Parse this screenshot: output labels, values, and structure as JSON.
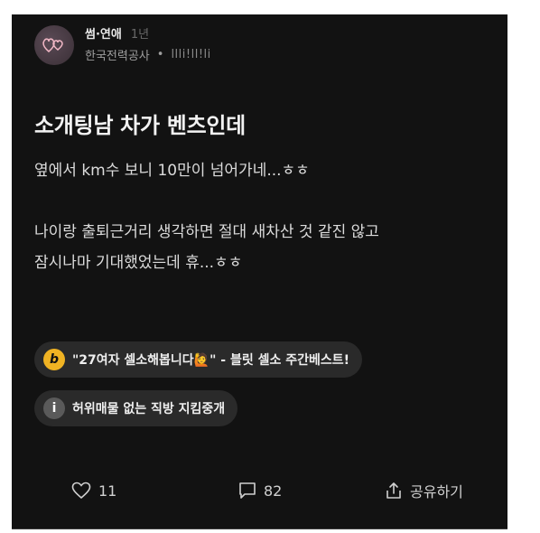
{
  "post": {
    "author": "썸·연애",
    "time": "1년",
    "company": "한국전력공사",
    "separator": "•",
    "handle": "llli!ll!li",
    "title": "소개팅남 차가 벤츠인데",
    "body_lines": [
      "옆에서 km수 보니 10만이 넘어가네...ㅎㅎ",
      "나이랑 출퇴근거리 생각하면 절대 새차산 것 같진 않고",
      "잠시나마 기대했었는데 휴...ㅎㅎ"
    ]
  },
  "chips": [
    {
      "icon_glyph": "b",
      "icon_name": "blind-logo-icon",
      "text": "\"27여자 셀소해봅니다🙋\" - 블릿 셀소 주간베스트!",
      "icon_color": "#f0b323"
    },
    {
      "icon_glyph": "i",
      "icon_name": "info-icon",
      "text": "허위매물 없는 직방 지킴중개",
      "icon_color": "#5a5a5a"
    }
  ],
  "actions": {
    "like_count": "11",
    "comment_count": "82",
    "share_label": "공유하기"
  },
  "colors": {
    "background": "#121212",
    "chip_bg": "#2a2a2a",
    "accent_yellow": "#f0b323"
  }
}
